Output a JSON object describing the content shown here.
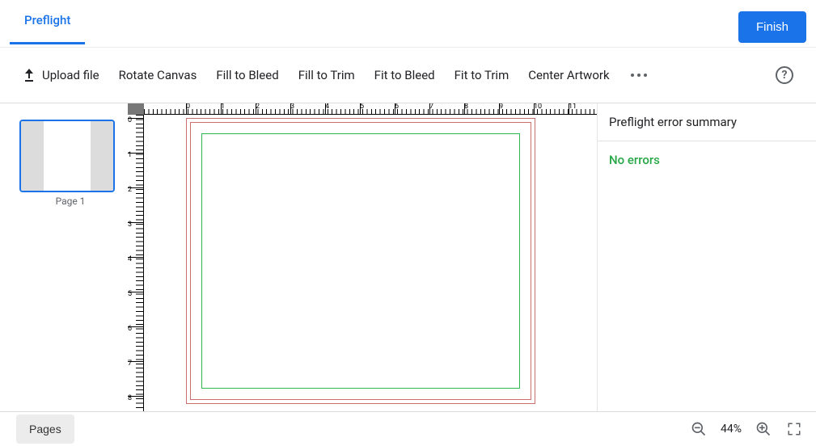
{
  "header": {
    "tab_label": "Preflight",
    "finish_label": "Finish"
  },
  "toolbar": {
    "upload_label": "Upload file",
    "rotate_label": "Rotate Canvas",
    "fill_bleed_label": "Fill to Bleed",
    "fill_trim_label": "Fill to Trim",
    "fit_bleed_label": "Fit to Bleed",
    "fit_trim_label": "Fit to Trim",
    "center_label": "Center Artwork",
    "help_glyph": "?"
  },
  "thumbs": {
    "page1_label": "Page 1"
  },
  "ruler": {
    "h_ticks": [
      "0",
      "1",
      "2",
      "3",
      "4",
      "5",
      "6",
      "7",
      "8",
      "9",
      "10",
      "11"
    ],
    "v_ticks": [
      "0",
      "1",
      "2",
      "3",
      "4",
      "5",
      "6",
      "7",
      "8"
    ]
  },
  "right_panel": {
    "title": "Preflight error summary",
    "status": "No errors"
  },
  "footer": {
    "pages_label": "Pages",
    "zoom_label": "44%"
  }
}
